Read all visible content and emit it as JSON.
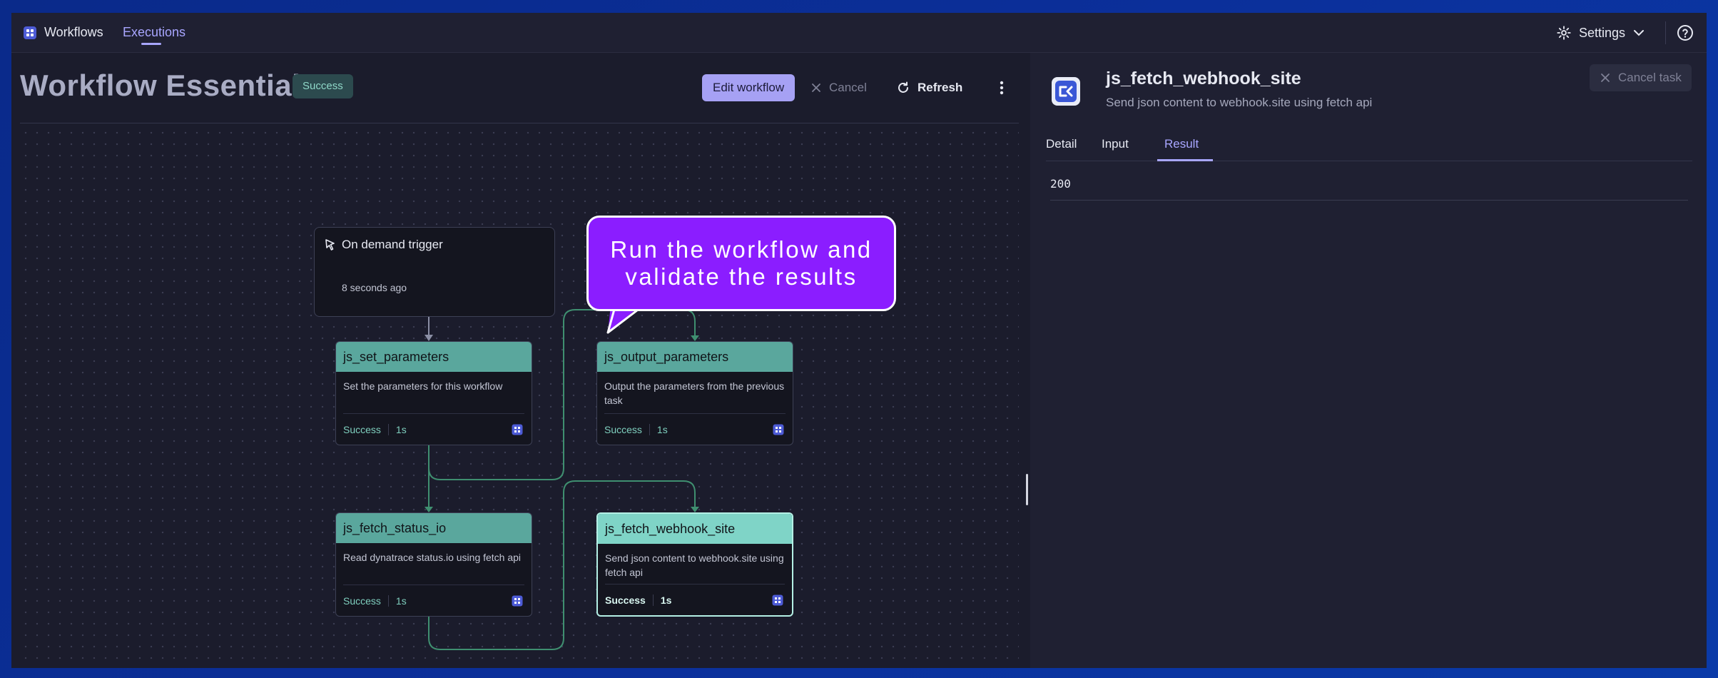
{
  "nav": {
    "app_label": "Workflows",
    "executions_label": "Executions",
    "settings_label": "Settings"
  },
  "header": {
    "title": "Workflow Essentials",
    "status": "Success",
    "edit_label": "Edit workflow",
    "cancel_label": "Cancel",
    "refresh_label": "Refresh"
  },
  "trigger": {
    "title": "On demand trigger",
    "time": "8 seconds ago"
  },
  "tasks": [
    {
      "name": "js_set_parameters",
      "desc": "Set the parameters for this workflow",
      "status": "Success",
      "duration": "1s"
    },
    {
      "name": "js_output_parameters",
      "desc": "Output the parameters from the previous task",
      "status": "Success",
      "duration": "1s"
    },
    {
      "name": "js_fetch_status_io",
      "desc": "Read dynatrace status.io using fetch api",
      "status": "Success",
      "duration": "1s"
    },
    {
      "name": "js_fetch_webhook_site",
      "desc": "Send json content to webhook.site using fetch api",
      "status": "Success",
      "duration": "1s"
    }
  ],
  "callout": {
    "text": "Run the workflow and validate the results",
    "color": "#8b1dff"
  },
  "detail": {
    "title": "js_fetch_webhook_site",
    "subtitle": "Send json content to webhook.site using fetch api",
    "cancel_task_label": "Cancel task",
    "tabs": [
      "Detail",
      "Input",
      "Result"
    ],
    "active_tab": "Result",
    "result_value": "200"
  },
  "colors": {
    "accent": "#a8a6ff",
    "success": "#7fcfbe",
    "node_header": "#5aa79d",
    "node_header_active": "#7fd4c7",
    "edge": "#3f8f70"
  },
  "icons": {
    "app": "workflows-icon",
    "trigger": "cursor-click-icon",
    "refresh": "refresh-icon",
    "cancel": "close-icon",
    "settings": "gear-icon",
    "help": "help-icon",
    "task": "task-grid-icon"
  }
}
